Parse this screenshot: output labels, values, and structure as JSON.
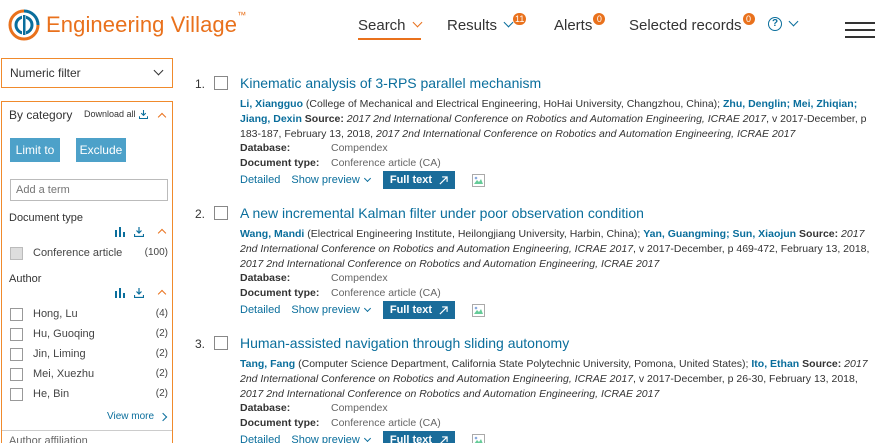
{
  "header": {
    "logo_text": "Engineering Village",
    "logo_tm": "™",
    "nav": {
      "search": "Search",
      "results": "Results",
      "results_badge": "11",
      "alerts": "Alerts",
      "alerts_badge": "0",
      "selected": "Selected records",
      "selected_badge": "0",
      "help": "?"
    }
  },
  "sidebar": {
    "numeric_filter": "Numeric filter",
    "by_category": "By category",
    "download_all": "Download all",
    "limit_btn": "Limit to",
    "exclude_btn": "Exclude",
    "term_placeholder": "Add a term",
    "doc_type": {
      "title": "Document type",
      "items": [
        {
          "label": "Conference article",
          "count": "(100)"
        }
      ]
    },
    "author": {
      "title": "Author",
      "items": [
        {
          "label": "Hong, Lu",
          "count": "(4)"
        },
        {
          "label": "Hu, Guoqing",
          "count": "(2)"
        },
        {
          "label": "Jin, Liming",
          "count": "(2)"
        },
        {
          "label": "Mei, Xuezhu",
          "count": "(2)"
        },
        {
          "label": "He, Bin",
          "count": "(2)"
        }
      ]
    },
    "view_more": "View more",
    "author_affiliation": "Author affiliation"
  },
  "results": [
    {
      "num": "1.",
      "title": "Kinematic analysis of 3-RPS parallel mechanism",
      "author1": "Li, Xiangguo",
      "aff1": " (College of Mechanical and Electrical Engineering, HoHai University, Changzhou, China); ",
      "author2": "Zhu, Denglin",
      "sep2": "; ",
      "author3": "Mei, Zhiqian",
      "sep3": "; ",
      "author4": "Jiang, Dexin",
      "source_label": " Source: ",
      "source1": "2017 2nd International Conference on Robotics and Automation Engineering, ICRAE 2017",
      "source_mid": ", v 2017-December, p 183-187, February 13, 2018, ",
      "source2": "2017 2nd International Conference on Robotics and Automation Engineering, ICRAE 2017",
      "database_label": "Database:",
      "database": "Compendex",
      "doctype_label": "Document type:",
      "doctype": "Conference article (CA)",
      "detailed": "Detailed",
      "preview": "Show preview",
      "fulltext": "Full text"
    },
    {
      "num": "2.",
      "title": "A new incremental Kalman filter under poor observation condition",
      "author1": "Wang, Mandi",
      "aff1": " (Electrical Engineering Institute, Heilongjiang University, Harbin, China); ",
      "author2": "Yan, Guangming",
      "sep2": "; ",
      "author3": "Sun, Xiaojun",
      "source_label": " Source: ",
      "source1": "2017 2nd International Conference on Robotics and Automation Engineering, ICRAE 2017",
      "source_mid": ", v 2017-December, p 469-472, February 13, 2018, ",
      "source2": "2017 2nd International Conference on Robotics and Automation Engineering, ICRAE 2017",
      "database_label": "Database:",
      "database": "Compendex",
      "doctype_label": "Document type:",
      "doctype": "Conference article (CA)",
      "detailed": "Detailed",
      "preview": "Show preview",
      "fulltext": "Full text"
    },
    {
      "num": "3.",
      "title": "Human-assisted navigation through sliding autonomy",
      "author1": "Tang, Fang",
      "aff1": " (Computer Science Department, California State Polytechnic University, Pomona, United States); ",
      "author2": "Ito, Ethan",
      "source_label": " Source: ",
      "source1": "2017 2nd International Conference on Robotics and Automation Engineering, ICRAE 2017",
      "source_mid": ", v 2017-December, p 26-30, February 13, 2018, ",
      "source2": "2017 2nd International Conference on Robotics and Automation Engineering, ICRAE 2017",
      "database_label": "Database:",
      "database": "Compendex",
      "doctype_label": "Document type:",
      "doctype": "Conference article (CA)",
      "detailed": "Detailed",
      "preview": "Show preview",
      "fulltext": "Full text"
    }
  ],
  "colors": {
    "brand_orange": "#e9711c",
    "link_blue": "#0a6e9c",
    "button_blue": "#4da1c9",
    "fulltext_blue": "#1a6c9a"
  }
}
